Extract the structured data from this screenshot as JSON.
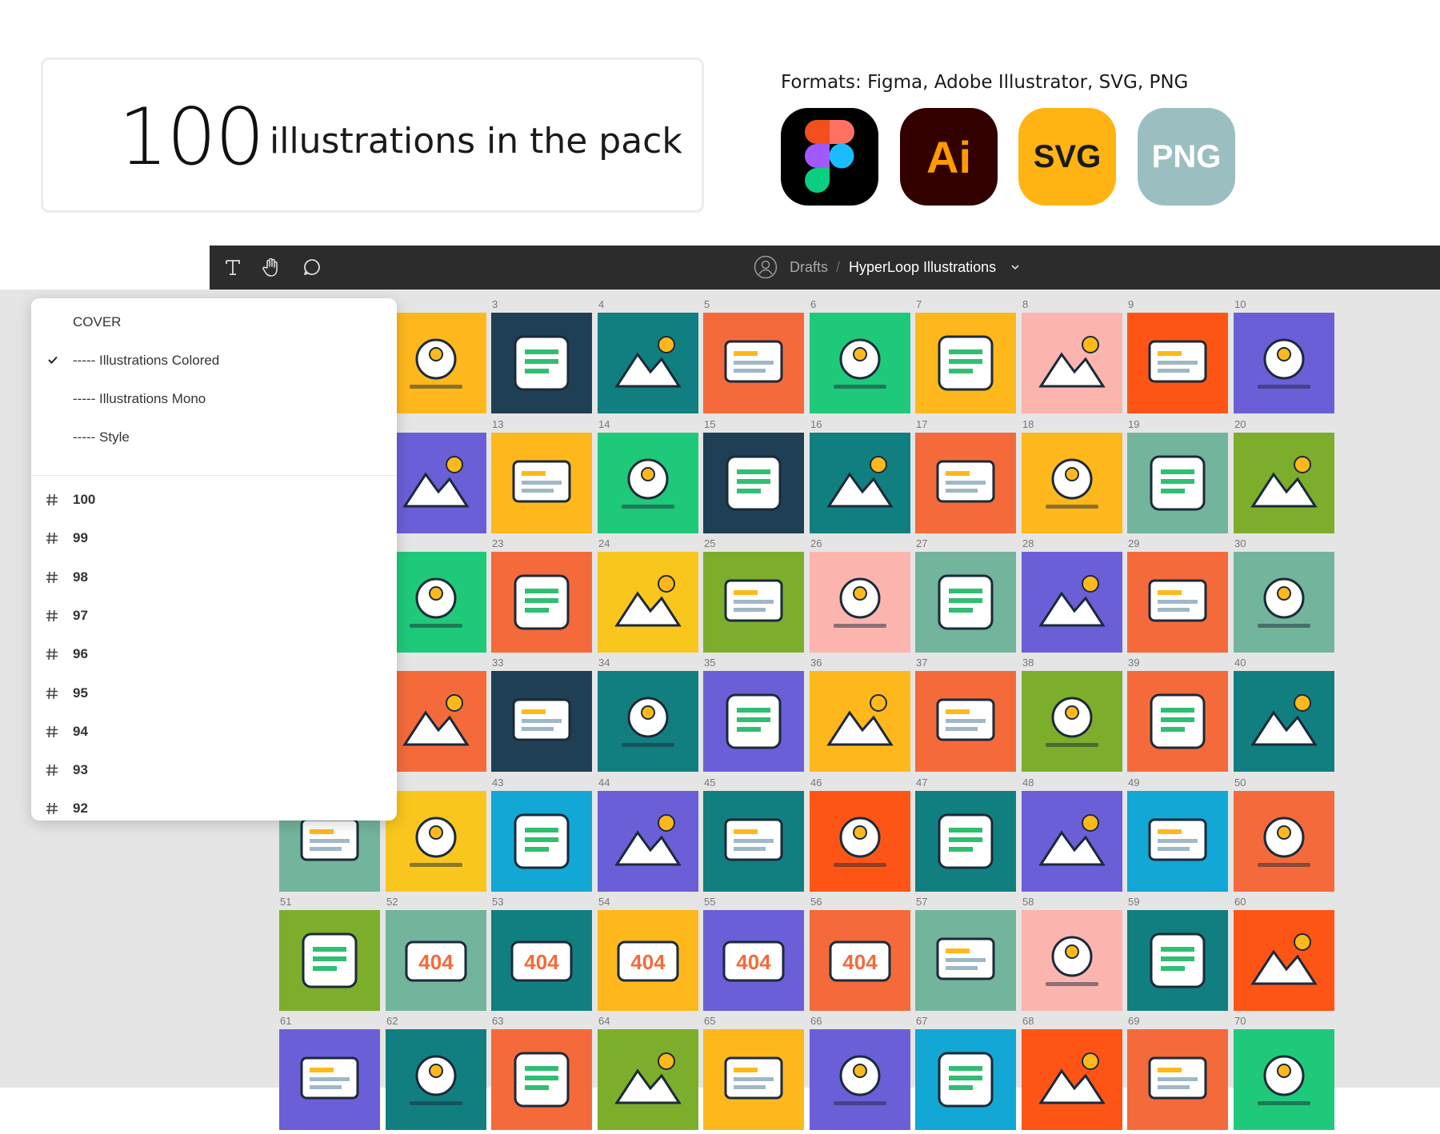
{
  "stats": {
    "number": "100",
    "label": "illustrations in the pack"
  },
  "formats": {
    "label": "Formats: Figma, Adobe Illustrator, SVG, PNG",
    "tiles": [
      {
        "name": "figma",
        "text": ""
      },
      {
        "name": "ai",
        "text": "Ai"
      },
      {
        "name": "svg",
        "text": "SVG"
      },
      {
        "name": "png",
        "text": "PNG"
      }
    ]
  },
  "toolbar": {
    "tools": [
      "text-tool-icon",
      "hand-tool-icon",
      "comment-tool-icon"
    ],
    "breadcrumb": {
      "drafts": "Drafts",
      "separator": "/",
      "file": "HyperLoop Illustrations"
    }
  },
  "pages_menu": {
    "pages": [
      {
        "label": "COVER",
        "selected": false
      },
      {
        "label": "----- Illustrations Colored",
        "selected": true
      },
      {
        "label": "----- Illustrations Mono",
        "selected": false
      },
      {
        "label": "----- Style",
        "selected": false
      }
    ],
    "frames": [
      "100",
      "99",
      "98",
      "97",
      "96",
      "95",
      "94",
      "93",
      "92"
    ]
  },
  "grid": {
    "row_labels": [
      [
        "3",
        "4",
        "5",
        "6",
        "7",
        "8",
        "9",
        "10"
      ],
      [
        "13",
        "14",
        "15",
        "16",
        "17",
        "18",
        "19",
        "20"
      ],
      [
        "23",
        "24",
        "25",
        "26",
        "27",
        "28",
        "29",
        "30"
      ],
      [
        "33",
        "34",
        "35",
        "36",
        "37",
        "38",
        "39",
        "40"
      ],
      [
        "43",
        "44",
        "45",
        "46",
        "47",
        "48",
        "49",
        "50"
      ],
      [
        "51",
        "52",
        "53",
        "54",
        "55",
        "56",
        "57",
        "58",
        "59",
        "60"
      ],
      [
        "61",
        "62",
        "63",
        "64",
        "65",
        "66",
        "67",
        "68",
        "69",
        "70"
      ]
    ],
    "thumb_texts": [
      "404",
      "404",
      "404",
      "404",
      "404"
    ],
    "colors": {
      "orange": "#f46a3b",
      "teal": "#117f80",
      "navy": "#1f3f54",
      "yellow": "#ffb81c",
      "green": "#1fc97a",
      "purple": "#6b5fd8",
      "pink": "#fbb5ae",
      "red": "#fe5516",
      "sage": "#72b49c",
      "olive": "#7cae2c",
      "cyan": "#12a7d4",
      "gold": "#f9c61d"
    }
  }
}
